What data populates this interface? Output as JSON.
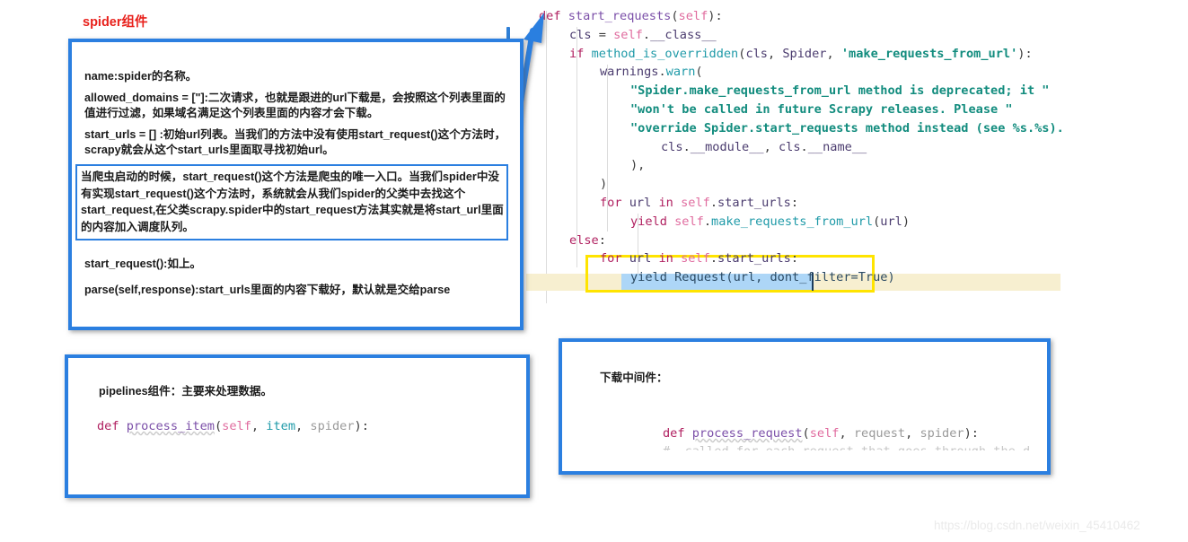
{
  "page": {
    "title": "spider组件",
    "watermark": "https://blog.csdn.net/weixin_45410462"
  },
  "spider_box": {
    "name_line": "name:spider的名称。",
    "allowed_domains_line": "allowed_domains = [\"]:二次请求，也就是跟进的url下载是，会按照这个列表里面的值进行过滤，如果域名满足这个列表里面的内容才会下载。",
    "start_urls_line": "start_urls = [] :初始url列表。当我们的方法中没有使用start_request()这个方法时，scrapy就会从这个start_urls里面取寻找初始url。",
    "highlighted_note": "当爬虫启动的时候，start_request()这个方法是爬虫的唯一入口。当我们spider中没有实现start_request()这个方法时，系统就会从我们spider的父类中去找这个start_request,在父类scrapy.spider中的start_request方法其实就是将start_url里面的内容加入调度队列。",
    "start_request_line": "start_request():如上。",
    "parse_line": "parse(self,response):start_urls里面的内容下载好，默认就是交给parse"
  },
  "pipelines_box": {
    "heading": "pipelines组件：主要来处理数据。",
    "code": {
      "kw_def": "def",
      "fn_name": "process_item",
      "open_paren": "(",
      "arg_self": "self",
      "sep1": ", ",
      "arg_item": "item",
      "sep2": ", ",
      "arg_spider": "spider",
      "close": "):"
    }
  },
  "downloader_box": {
    "heading": "下载中间件：",
    "code": {
      "kw_def": "def",
      "fn_name": "process_request",
      "open_paren": "(",
      "arg_self": "self",
      "sep1": ", ",
      "arg_request": "request",
      "sep2": ", ",
      "arg_spider": "spider",
      "close": "):"
    }
  },
  "editor": {
    "lines": [
      {
        "indent": 0,
        "tokens": [
          [
            "k",
            "def"
          ],
          [
            "pl",
            " "
          ],
          [
            "fn",
            "start_requests"
          ],
          [
            "pl",
            "("
          ],
          [
            "self",
            "self"
          ],
          [
            "pl",
            "):"
          ]
        ]
      },
      {
        "indent": 1,
        "tokens": [
          [
            "id",
            "cls"
          ],
          [
            "pl",
            " = "
          ],
          [
            "self",
            "self"
          ],
          [
            "pl",
            "."
          ],
          [
            "id",
            "__class__"
          ]
        ]
      },
      {
        "indent": 1,
        "tokens": [
          [
            "k",
            "if"
          ],
          [
            "pl",
            " "
          ],
          [
            "call",
            "method_is_overridden"
          ],
          [
            "pl",
            "("
          ],
          [
            "id",
            "cls"
          ],
          [
            "pl",
            ", "
          ],
          [
            "id",
            "Spider"
          ],
          [
            "pl",
            ", "
          ],
          [
            "str",
            "'make_requests_from_url'"
          ],
          [
            "pl",
            "):"
          ]
        ]
      },
      {
        "indent": 2,
        "tokens": [
          [
            "id",
            "warnings"
          ],
          [
            "pl",
            "."
          ],
          [
            "call",
            "warn"
          ],
          [
            "pl",
            "("
          ]
        ]
      },
      {
        "indent": 3,
        "tokens": [
          [
            "str",
            "\"Spider.make_requests_from_url method is deprecated; it \""
          ]
        ]
      },
      {
        "indent": 3,
        "tokens": [
          [
            "str",
            "\"won't be called in future Scrapy releases. Please \""
          ]
        ]
      },
      {
        "indent": 3,
        "tokens": [
          [
            "str",
            "\"override Spider.start_requests method instead (see %s.%s)."
          ]
        ]
      },
      {
        "indent": 4,
        "tokens": [
          [
            "id",
            "cls"
          ],
          [
            "pl",
            "."
          ],
          [
            "id",
            "__module__"
          ],
          [
            "pl",
            ", "
          ],
          [
            "id",
            "cls"
          ],
          [
            "pl",
            "."
          ],
          [
            "id",
            "__name__"
          ]
        ]
      },
      {
        "indent": 3,
        "tokens": [
          [
            "pl",
            "),"
          ]
        ]
      },
      {
        "indent": 2,
        "tokens": [
          [
            "pl",
            ")"
          ]
        ]
      },
      {
        "indent": 2,
        "tokens": [
          [
            "k",
            "for"
          ],
          [
            "pl",
            " "
          ],
          [
            "id",
            "url"
          ],
          [
            "pl",
            " "
          ],
          [
            "k",
            "in"
          ],
          [
            "pl",
            " "
          ],
          [
            "self",
            "self"
          ],
          [
            "pl",
            "."
          ],
          [
            "id",
            "start_urls"
          ],
          [
            "pl",
            ":"
          ]
        ]
      },
      {
        "indent": 3,
        "tokens": [
          [
            "k",
            "yield"
          ],
          [
            "pl",
            " "
          ],
          [
            "self",
            "self"
          ],
          [
            "pl",
            "."
          ],
          [
            "call",
            "make_requests_from_url"
          ],
          [
            "pl",
            "("
          ],
          [
            "id",
            "url"
          ],
          [
            "pl",
            ")"
          ]
        ]
      },
      {
        "indent": 1,
        "tokens": [
          [
            "k",
            "else"
          ],
          [
            "pl",
            ":"
          ]
        ]
      },
      {
        "indent": 2,
        "tokens": [
          [
            "k",
            "for"
          ],
          [
            "pl",
            " "
          ],
          [
            "id",
            "url"
          ],
          [
            "pl",
            " "
          ],
          [
            "k",
            "in"
          ],
          [
            "pl",
            " "
          ],
          [
            "self",
            "self"
          ],
          [
            "pl",
            "."
          ],
          [
            "id",
            "start_urls"
          ],
          [
            "pl",
            ":"
          ]
        ]
      },
      {
        "indent": 3,
        "tokens": [
          [
            "sel",
            "yield Request(url, dont_filter=True)"
          ]
        ]
      }
    ],
    "selected_text": "yield Request(url, dont_filter=True)",
    "annotation_color": "#ffe400",
    "selection_color": "#add6f7",
    "current_line_color": "#f7efd0"
  },
  "colors": {
    "callout_border": "#2b7fe0",
    "title": "#e8211c",
    "keyword": "#b02060",
    "string": "#128c7e",
    "call": "#1f9aa8",
    "self": "#e06c9f"
  }
}
